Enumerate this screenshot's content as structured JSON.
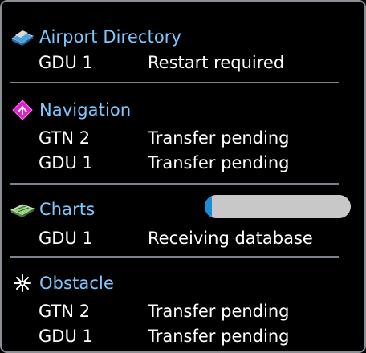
{
  "sections": [
    {
      "title": "Airport Directory",
      "icon": "airport-directory-icon",
      "rows": [
        {
          "unit": "GDU 1",
          "status": "Restart required"
        }
      ]
    },
    {
      "title": "Navigation",
      "icon": "navigation-icon",
      "rows": [
        {
          "unit": "GTN 2",
          "status": "Transfer pending"
        },
        {
          "unit": "GDU 1",
          "status": "Transfer pending"
        }
      ]
    },
    {
      "title": "Charts",
      "icon": "charts-icon",
      "progress": 0.05,
      "rows": [
        {
          "unit": "GDU 1",
          "status": "Receiving database"
        }
      ]
    },
    {
      "title": "Obstacle",
      "icon": "obstacle-icon",
      "rows": [
        {
          "unit": "GTN 2",
          "status": "Transfer pending"
        },
        {
          "unit": "GDU 1",
          "status": "Transfer pending"
        }
      ]
    }
  ],
  "colors": {
    "title": "#7fc7ff",
    "text": "#ffffff",
    "divider": "#7d838a",
    "progress_track": "#c8c8c8",
    "progress_fill": "#1a8fd8"
  }
}
